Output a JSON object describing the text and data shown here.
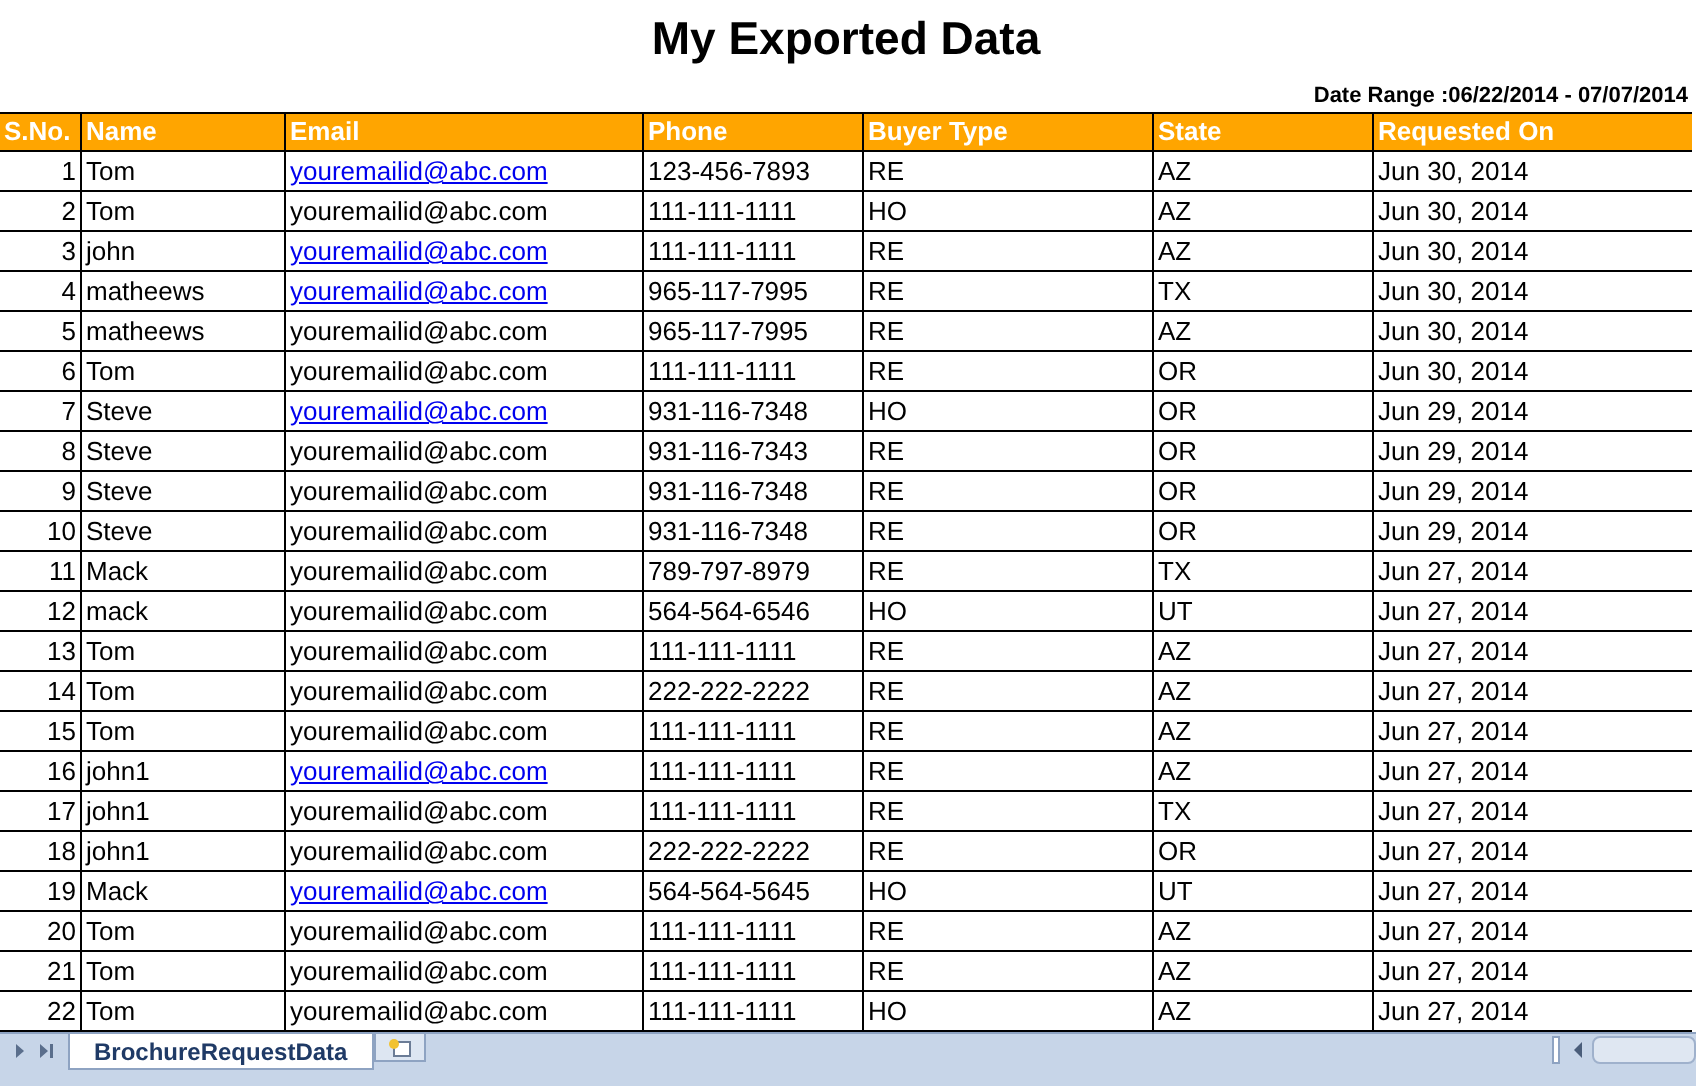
{
  "title": "My Exported Data",
  "date_range": "Date Range :06/22/2014 - 07/07/2014",
  "columns": [
    "S.No.",
    "Name",
    "Email",
    "Phone",
    "Buyer Type",
    "State",
    "Requested On"
  ],
  "rows": [
    {
      "no": "1",
      "name": "Tom",
      "email": "youremailid@abc.com",
      "link": true,
      "phone": "123-456-7893",
      "buyer": "RE",
      "state": "AZ",
      "date": "Jun 30, 2014"
    },
    {
      "no": "2",
      "name": "Tom",
      "email": "youremailid@abc.com",
      "link": false,
      "phone": "111-111-1111",
      "buyer": "HO",
      "state": "AZ",
      "date": "Jun 30, 2014"
    },
    {
      "no": "3",
      "name": "john",
      "email": "youremailid@abc.com",
      "link": true,
      "phone": "111-111-1111",
      "buyer": "RE",
      "state": "AZ",
      "date": "Jun 30, 2014"
    },
    {
      "no": "4",
      "name": "matheews",
      "email": "youremailid@abc.com",
      "link": true,
      "phone": "965-117-7995",
      "buyer": "RE",
      "state": "TX",
      "date": "Jun 30, 2014"
    },
    {
      "no": "5",
      "name": "matheews",
      "email": "youremailid@abc.com",
      "link": false,
      "phone": "965-117-7995",
      "buyer": "RE",
      "state": "AZ",
      "date": "Jun 30, 2014"
    },
    {
      "no": "6",
      "name": "Tom",
      "email": "youremailid@abc.com",
      "link": false,
      "phone": "111-111-1111",
      "buyer": "RE",
      "state": "OR",
      "date": "Jun 30, 2014"
    },
    {
      "no": "7",
      "name": "Steve",
      "email": "youremailid@abc.com",
      "link": true,
      "phone": "931-116-7348",
      "buyer": "HO",
      "state": "OR",
      "date": "Jun 29, 2014"
    },
    {
      "no": "8",
      "name": "Steve",
      "email": "youremailid@abc.com",
      "link": false,
      "phone": "931-116-7343",
      "buyer": "RE",
      "state": "OR",
      "date": "Jun 29, 2014"
    },
    {
      "no": "9",
      "name": "Steve",
      "email": "youremailid@abc.com",
      "link": false,
      "phone": "931-116-7348",
      "buyer": "RE",
      "state": "OR",
      "date": "Jun 29, 2014"
    },
    {
      "no": "10",
      "name": "Steve",
      "email": "youremailid@abc.com",
      "link": false,
      "phone": "931-116-7348",
      "buyer": "RE",
      "state": "OR",
      "date": "Jun 29, 2014"
    },
    {
      "no": "11",
      "name": "Mack",
      "email": "youremailid@abc.com",
      "link": false,
      "phone": "789-797-8979",
      "buyer": "RE",
      "state": "TX",
      "date": "Jun 27, 2014"
    },
    {
      "no": "12",
      "name": "mack",
      "email": "youremailid@abc.com",
      "link": false,
      "phone": "564-564-6546",
      "buyer": "HO",
      "state": "UT",
      "date": "Jun 27, 2014"
    },
    {
      "no": "13",
      "name": "Tom",
      "email": "youremailid@abc.com",
      "link": false,
      "phone": "111-111-1111",
      "buyer": "RE",
      "state": "AZ",
      "date": "Jun 27, 2014"
    },
    {
      "no": "14",
      "name": "Tom",
      "email": "youremailid@abc.com",
      "link": false,
      "phone": "222-222-2222",
      "buyer": "RE",
      "state": "AZ",
      "date": "Jun 27, 2014"
    },
    {
      "no": "15",
      "name": "Tom",
      "email": "youremailid@abc.com",
      "link": false,
      "phone": "111-111-1111",
      "buyer": "RE",
      "state": "AZ",
      "date": "Jun 27, 2014"
    },
    {
      "no": "16",
      "name": "john1",
      "email": "youremailid@abc.com",
      "link": true,
      "phone": "111-111-1111",
      "buyer": "RE",
      "state": "AZ",
      "date": "Jun 27, 2014"
    },
    {
      "no": "17",
      "name": "john1",
      "email": "youremailid@abc.com",
      "link": false,
      "phone": "111-111-1111",
      "buyer": "RE",
      "state": "TX",
      "date": "Jun 27, 2014"
    },
    {
      "no": "18",
      "name": "john1",
      "email": "youremailid@abc.com",
      "link": false,
      "phone": "222-222-2222",
      "buyer": "RE",
      "state": "OR",
      "date": "Jun 27, 2014"
    },
    {
      "no": "19",
      "name": "Mack",
      "email": "youremailid@abc.com",
      "link": true,
      "phone": "564-564-5645",
      "buyer": "HO",
      "state": "UT",
      "date": "Jun 27, 2014"
    },
    {
      "no": "20",
      "name": "Tom",
      "email": "youremailid@abc.com",
      "link": false,
      "phone": "111-111-1111",
      "buyer": "RE",
      "state": "AZ",
      "date": "Jun 27, 2014"
    },
    {
      "no": "21",
      "name": "Tom",
      "email": "youremailid@abc.com",
      "link": false,
      "phone": "111-111-1111",
      "buyer": "RE",
      "state": "AZ",
      "date": "Jun 27, 2014"
    },
    {
      "no": "22",
      "name": "Tom",
      "email": "youremailid@abc.com",
      "link": false,
      "phone": "111-111-1111",
      "buyer": "HO",
      "state": "AZ",
      "date": "Jun 27, 2014"
    }
  ],
  "sheet_tabs": [
    {
      "label": "BrochureRequestData",
      "selected": true
    }
  ]
}
